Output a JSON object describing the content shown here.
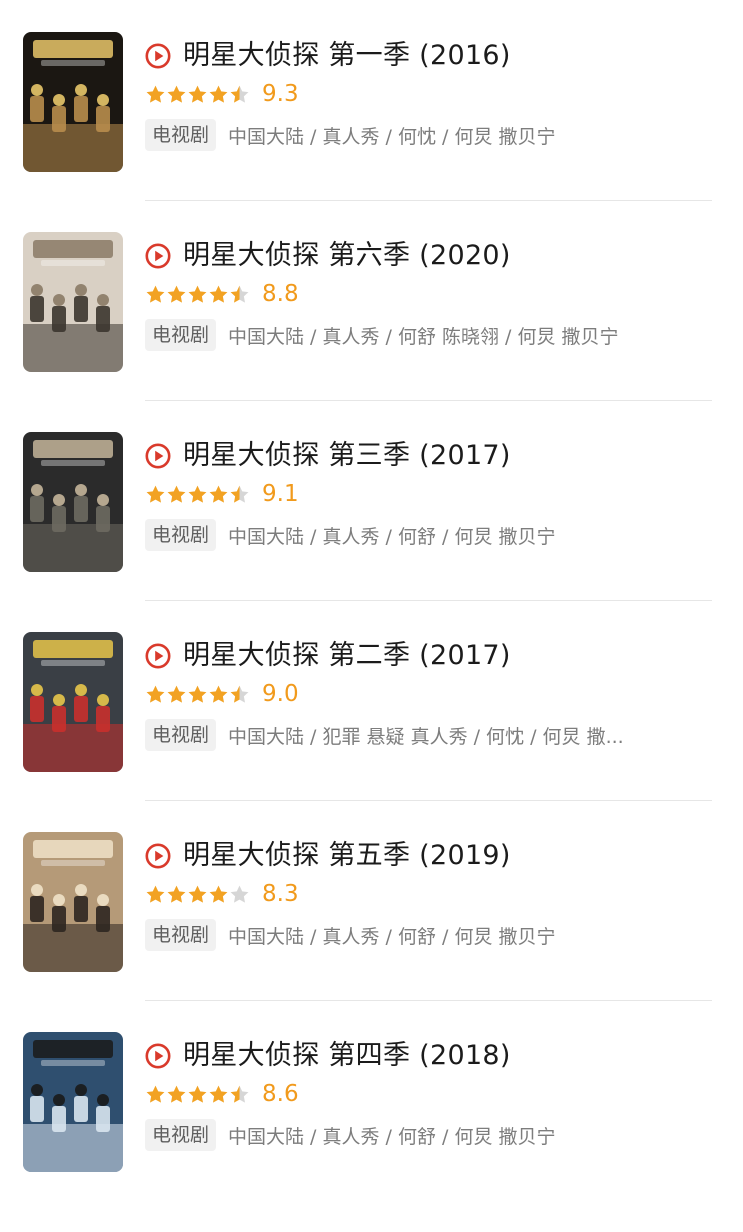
{
  "items": [
    {
      "title": "明星大侦探 第一季 (2016)",
      "rating": 9.3,
      "stars": 4.5,
      "tag": "电视剧",
      "meta": "中国大陆 / 真人秀 / 何忱 / 何炅 撒贝宁",
      "poster_colors": [
        "#1b1712",
        "#b88d4d",
        "#e8c66a"
      ]
    },
    {
      "title": "明星大侦探 第六季 (2020)",
      "rating": 8.8,
      "stars": 4.5,
      "tag": "电视剧",
      "meta": "中国大陆 / 真人秀 / 何舒 陈晓翎 / 何炅 撒贝宁",
      "poster_colors": [
        "#d9d0c4",
        "#3b352f",
        "#8a7a66"
      ]
    },
    {
      "title": "明星大侦探 第三季 (2017)",
      "rating": 9.1,
      "stars": 4.5,
      "tag": "电视剧",
      "meta": "中国大陆 / 真人秀 / 何舒 / 何炅 撒贝宁",
      "poster_colors": [
        "#2b2b2b",
        "#6d6a60",
        "#c4b59a"
      ]
    },
    {
      "title": "明星大侦探 第二季 (2017)",
      "rating": 9.0,
      "stars": 4.5,
      "tag": "电视剧",
      "meta": "中国大陆 / 犯罪 悬疑 真人秀 / 何忱 / 何炅 撒...",
      "poster_colors": [
        "#3a3f45",
        "#c9302c",
        "#e8c64a"
      ]
    },
    {
      "title": "明星大侦探 第五季 (2019)",
      "rating": 8.3,
      "stars": 4,
      "tag": "电视剧",
      "meta": "中国大陆 / 真人秀 / 何舒 / 何炅 撒贝宁",
      "poster_colors": [
        "#b59a78",
        "#2d2620",
        "#f0e2c8"
      ]
    },
    {
      "title": "明星大侦探 第四季 (2018)",
      "rating": 8.6,
      "stars": 4.5,
      "tag": "电视剧",
      "meta": "中国大陆 / 真人秀 / 何舒 / 何炅 撒贝宁",
      "poster_colors": [
        "#2f4f6f",
        "#d8e4ee",
        "#1a1a1a"
      ]
    }
  ],
  "icons": {
    "play": "play-circle-icon",
    "star": "star-icon"
  },
  "colors": {
    "accent": "#d93a2b",
    "star": "#f2a223",
    "star_empty": "#d6d6d6",
    "score": "#f19a1c"
  }
}
